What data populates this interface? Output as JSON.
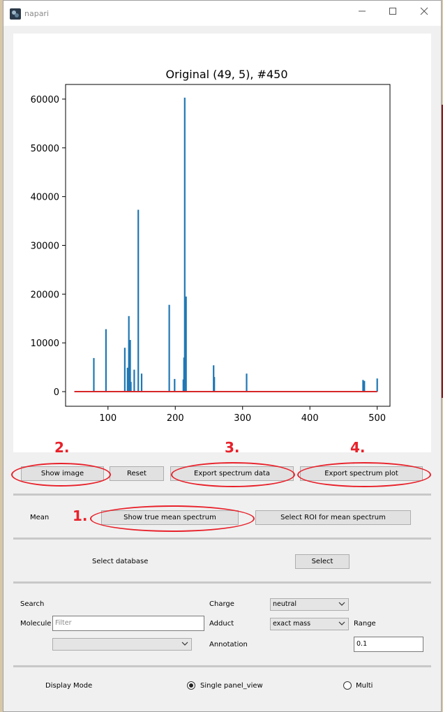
{
  "window": {
    "title": "napari",
    "minimize_glyph": "—",
    "maximize_glyph": "☐",
    "close_glyph": "✕"
  },
  "chart_data": {
    "type": "bar",
    "title": "Original (49, 5), #450",
    "xlabel": "",
    "ylabel": "",
    "xlim": [
      37,
      519
    ],
    "ylim": [
      -3000,
      63000
    ],
    "xticks": [
      100,
      200,
      300,
      400,
      500
    ],
    "yticks": [
      0,
      10000,
      20000,
      30000,
      40000,
      50000,
      60000
    ],
    "bar_color": "#1f77b4",
    "baseline_color": "#d62728",
    "baseline_x": [
      50,
      500
    ],
    "bars": [
      {
        "x": 79,
        "y": 6900
      },
      {
        "x": 97,
        "y": 12800
      },
      {
        "x": 125,
        "y": 9000
      },
      {
        "x": 129,
        "y": 4900
      },
      {
        "x": 131,
        "y": 15500
      },
      {
        "x": 133,
        "y": 10600
      },
      {
        "x": 134,
        "y": 2000
      },
      {
        "x": 139,
        "y": 4500
      },
      {
        "x": 145,
        "y": 37300
      },
      {
        "x": 150,
        "y": 3700
      },
      {
        "x": 191,
        "y": 17800
      },
      {
        "x": 199,
        "y": 2600
      },
      {
        "x": 212,
        "y": 2500
      },
      {
        "x": 213,
        "y": 7000
      },
      {
        "x": 214,
        "y": 60300
      },
      {
        "x": 216,
        "y": 19500
      },
      {
        "x": 257,
        "y": 5400
      },
      {
        "x": 258,
        "y": 3000
      },
      {
        "x": 306,
        "y": 3700
      },
      {
        "x": 479,
        "y": 2400
      },
      {
        "x": 481,
        "y": 2200
      },
      {
        "x": 500,
        "y": 2700
      }
    ]
  },
  "plot_buttons": {
    "show_image": "Show image",
    "reset": "Reset",
    "export_data": "Export spectrum data",
    "export_plot": "Export spectrum plot"
  },
  "mean": {
    "label": "Mean",
    "show_true": "Show true mean spectrum",
    "select_roi": "Select ROI for mean spectrum"
  },
  "database": {
    "label": "Select database",
    "select": "Select"
  },
  "search": {
    "search_label": "Search",
    "molecule_label": "Molecule",
    "molecule_placeholder": "Filter",
    "molecule_value": "",
    "charge_label": "Charge",
    "charge_value": "neutral",
    "adduct_label": "Adduct",
    "adduct_value": "exact mass",
    "range_label": "Range",
    "range_value": "0.1",
    "annotation_label": "Annotation",
    "annotation_combo_value": ""
  },
  "display": {
    "label": "Display Mode",
    "single": "Single panel_view",
    "multi": "Multi",
    "selected": "single"
  },
  "annotations": {
    "a1": "1.",
    "a2": "2.",
    "a3": "3.",
    "a4": "4.",
    "color": "#e8212a"
  }
}
